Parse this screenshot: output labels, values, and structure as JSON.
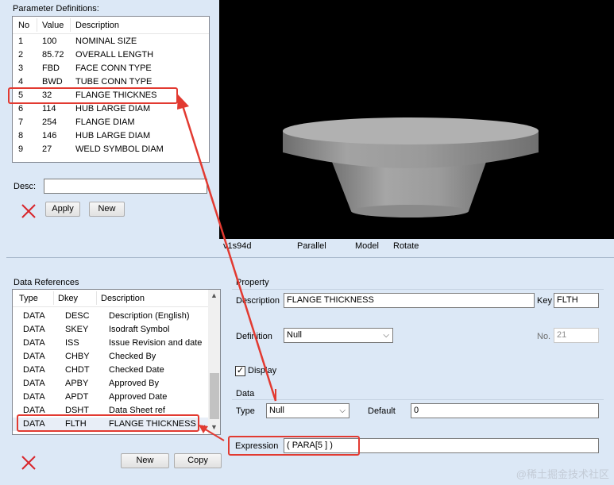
{
  "param_defs": {
    "title": "Parameter Definitions:",
    "columns": [
      "No",
      "Value",
      "Description"
    ],
    "rows": [
      {
        "no": "1",
        "value": "100",
        "desc": "NOMINAL SIZE"
      },
      {
        "no": "2",
        "value": "85.72",
        "desc": "OVERALL LENGTH"
      },
      {
        "no": "3",
        "value": "FBD",
        "desc": "FACE CONN TYPE"
      },
      {
        "no": "4",
        "value": "BWD",
        "desc": "TUBE CONN TYPE"
      },
      {
        "no": "5",
        "value": "32",
        "desc": "FLANGE THICKNES"
      },
      {
        "no": "6",
        "value": "114",
        "desc": "HUB LARGE DIAM"
      },
      {
        "no": "7",
        "value": "254",
        "desc": "FLANGE DIAM"
      },
      {
        "no": "8",
        "value": "146",
        "desc": "HUB LARGE DIAM"
      },
      {
        "no": "9",
        "value": "27",
        "desc": "WELD SYMBOL DIAM"
      }
    ],
    "desc_label": "Desc:",
    "desc_value": "",
    "apply_label": "Apply",
    "new_label": "New"
  },
  "viewport": {
    "status_items": [
      "v1s94d",
      "Parallel",
      "Model",
      "Rotate"
    ],
    "background": "#000000",
    "model_color": "#9b9b9b"
  },
  "data_refs": {
    "title": "Data References",
    "columns": [
      "Type",
      "Dkey",
      "Description"
    ],
    "rows": [
      {
        "type": "DATA",
        "dkey": "DESC",
        "desc": "Description (English)"
      },
      {
        "type": "DATA",
        "dkey": "SKEY",
        "desc": "Isodraft Symbol"
      },
      {
        "type": "DATA",
        "dkey": "ISS",
        "desc": "Issue Revision and date"
      },
      {
        "type": "DATA",
        "dkey": "CHBY",
        "desc": "Checked By"
      },
      {
        "type": "DATA",
        "dkey": "CHDT",
        "desc": "Checked Date"
      },
      {
        "type": "DATA",
        "dkey": "APBY",
        "desc": "Approved By"
      },
      {
        "type": "DATA",
        "dkey": "APDT",
        "desc": "Approved Date"
      },
      {
        "type": "DATA",
        "dkey": "DSHT",
        "desc": "Data Sheet ref"
      },
      {
        "type": "DATA",
        "dkey": "FLTH",
        "desc": "FLANGE THICKNESS ..."
      }
    ],
    "new_label": "New",
    "copy_label": "Copy"
  },
  "property": {
    "group_label": "Property",
    "description_label": "Description",
    "description_value": "FLANGE THICKNESS",
    "key_label": "Key",
    "key_value": "FLTH",
    "definition_label": "Definition",
    "definition_value": "Null",
    "no_label": "No.",
    "no_value": "21",
    "display_label": "Display",
    "display_checked": true,
    "data_group_label": "Data",
    "type_label": "Type",
    "type_value": "Null",
    "default_label": "Default",
    "default_value": "0",
    "expression_label": "Expression",
    "expression_value": "( PARA[5 ] )"
  },
  "watermark": "@稀土掘金技术社区",
  "colors": {
    "highlight": "#e23a31",
    "panel": "#dce8f6"
  }
}
